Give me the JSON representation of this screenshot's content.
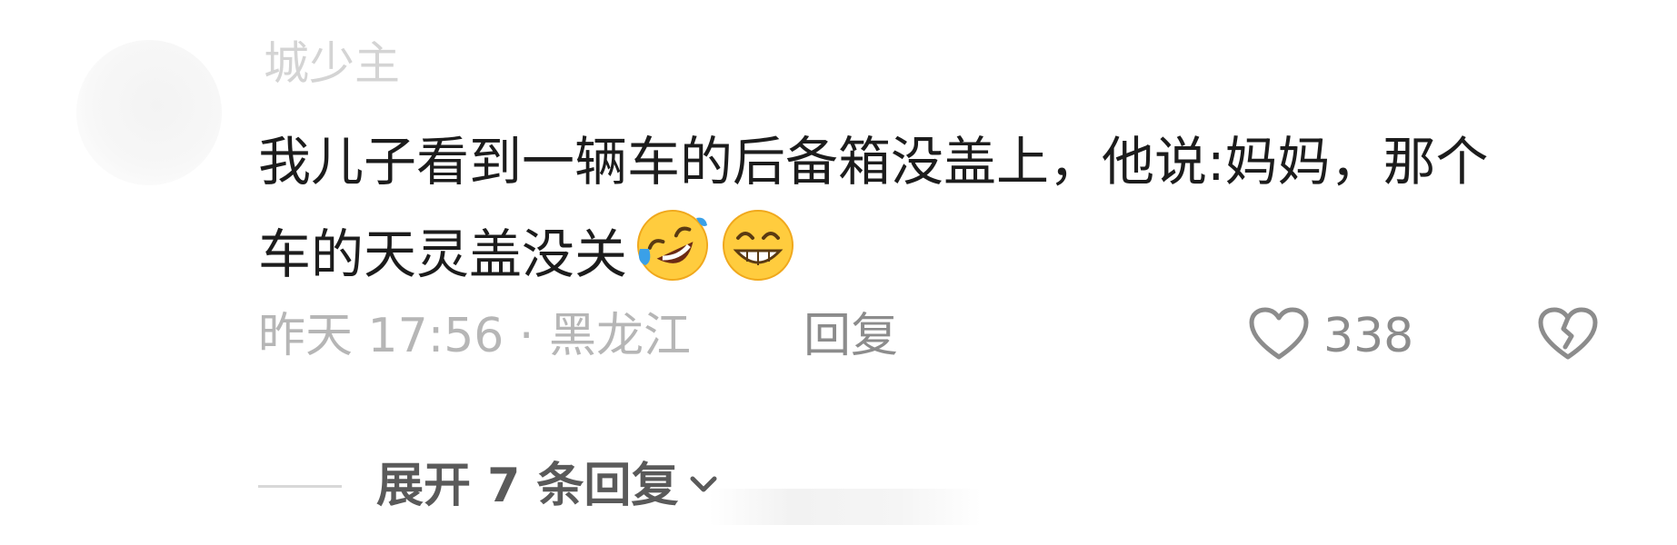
{
  "comment": {
    "username": "城少主",
    "text": "我儿子看到一辆车的后备箱没盖上，他说:妈妈，那个车的天灵盖没关",
    "emojis": [
      "rolling-on-floor-laughing-emoji",
      "grinning-face-emoji"
    ],
    "time_location": "昨天 17:56 · 黑龙江",
    "reply_label": "回复",
    "like_count": "338",
    "icons": {
      "like": "heart-outline-icon",
      "dislike": "broken-heart-icon",
      "expand": "chevron-down-icon"
    }
  },
  "replies": {
    "expand_label": "展开 7 条回复"
  }
}
